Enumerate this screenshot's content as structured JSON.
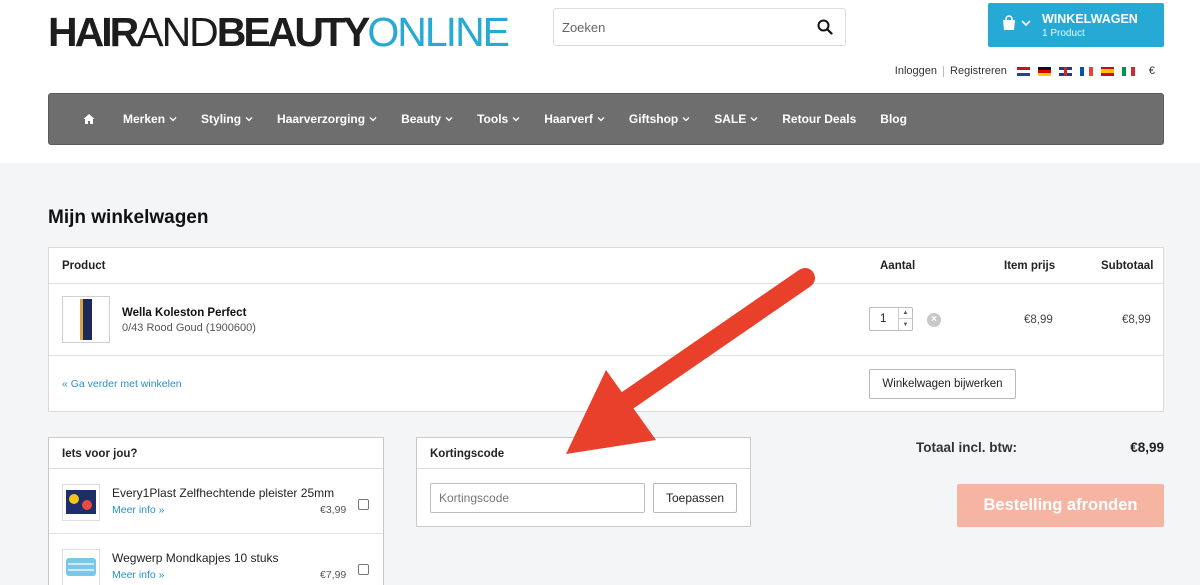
{
  "header": {
    "logo": {
      "part1": "HAIR",
      "part2": "AND",
      "part3": "BEAUTY",
      "part4": "ONLINE"
    },
    "search": {
      "placeholder": "Zoeken"
    },
    "cart": {
      "title": "WINKELWAGEN",
      "count": "1 Product"
    },
    "account": {
      "login": "Inloggen",
      "register": "Registreren"
    },
    "currency": "€",
    "flags": [
      "nl-flag",
      "de-flag",
      "uk-flag",
      "fr-flag",
      "es-flag",
      "it-flag"
    ]
  },
  "nav": {
    "items": [
      {
        "label": "Merken",
        "dropdown": true
      },
      {
        "label": "Styling",
        "dropdown": true
      },
      {
        "label": "Haarverzorging",
        "dropdown": true
      },
      {
        "label": "Beauty",
        "dropdown": true
      },
      {
        "label": "Tools",
        "dropdown": true
      },
      {
        "label": "Haarverf",
        "dropdown": true
      },
      {
        "label": "Giftshop",
        "dropdown": true
      },
      {
        "label": "SALE",
        "dropdown": true
      },
      {
        "label": "Retour Deals",
        "dropdown": false
      },
      {
        "label": "Blog",
        "dropdown": false
      }
    ]
  },
  "cart_page": {
    "title": "Mijn winkelwagen",
    "columns": {
      "product": "Product",
      "qty": "Aantal",
      "item_price": "Item prijs",
      "subtotal": "Subtotaal"
    },
    "items": [
      {
        "name": "Wella Koleston Perfect",
        "variant": "0/43 Rood Goud (1900600)",
        "qty": "1",
        "item_price": "€8,99",
        "subtotal": "€8,99"
      }
    ],
    "continue_link": "« Ga verder met winkelen",
    "update_button": "Winkelwagen bijwerken"
  },
  "suggestions": {
    "title": "Iets voor jou?",
    "items": [
      {
        "name": "Every1Plast Zelfhechtende pleister 25mm",
        "more": "Meer info »",
        "price": "€3,99"
      },
      {
        "name": "Wegwerp Mondkapjes 10 stuks",
        "more": "Meer info »",
        "price": "€7,99"
      }
    ]
  },
  "coupon": {
    "title": "Kortingscode",
    "placeholder": "Kortingscode",
    "apply": "Toepassen"
  },
  "totals": {
    "label": "Totaal incl. btw:",
    "value": "€8,99"
  },
  "checkout": {
    "label": "Bestelling afronden"
  },
  "colors": {
    "brand": "#27a9d6",
    "nav": "#6e6e6e",
    "checkout": "#f6b4a3",
    "arrow": "#e8402a"
  }
}
